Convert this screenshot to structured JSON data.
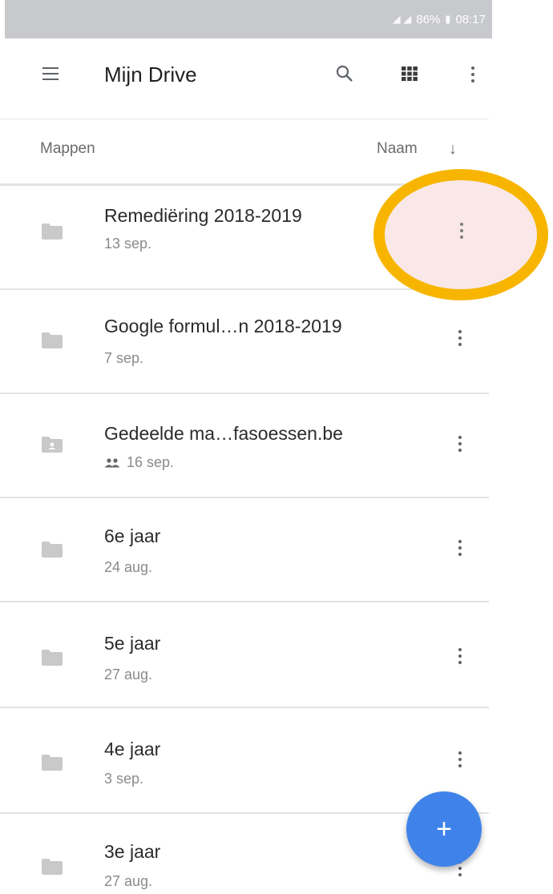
{
  "status_bar": {
    "signal_icons": "signal-icon",
    "battery": "86%",
    "time": "08:17"
  },
  "app_bar": {
    "title": "Mijn Drive",
    "menu_icon": "menu-icon",
    "search_icon": "search-icon",
    "view_icon": "grid-view-icon",
    "more_icon": "more-vert-icon"
  },
  "list_header": {
    "section_label": "Mappen",
    "sort_label": "Naam",
    "sort_icon": "arrow-down-icon"
  },
  "folders": [
    {
      "name": "Remediëring 2018-2019",
      "date": "13 sep.",
      "shared": false
    },
    {
      "name": "Google formul…n 2018-2019",
      "date": "7 sep.",
      "shared": false
    },
    {
      "name": "Gedeelde ma…fasoessen.be",
      "date": "16 sep.",
      "shared": true
    },
    {
      "name": "6e jaar",
      "date": "24 aug.",
      "shared": false
    },
    {
      "name": "5e jaar",
      "date": "27 aug.",
      "shared": false
    },
    {
      "name": "4e jaar",
      "date": "3 sep.",
      "shared": false
    },
    {
      "name": "3e jaar",
      "date": "27 aug.",
      "shared": false
    }
  ],
  "fab": {
    "label": "+"
  },
  "colors": {
    "accent": "#3f83ea",
    "highlight_ring": "#f7b500",
    "status_bar": "#c8c9cd",
    "folder_icon": "#c9c9c9"
  }
}
